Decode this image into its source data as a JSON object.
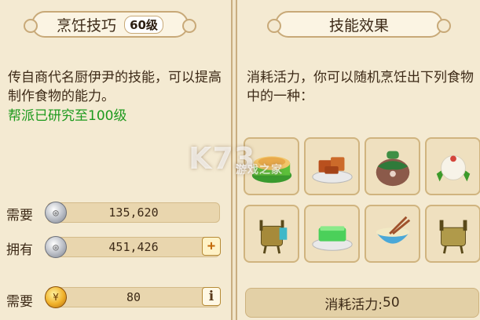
{
  "left": {
    "title": "烹饪技巧",
    "level": "60级",
    "description": "传自商代名厨伊尹的技能，可以提高制作食物的能力。",
    "guild_research": "帮派已研究至100级",
    "requirements": [
      {
        "label": "需要",
        "value": "135,620",
        "currency_icon": "silver-coin-icon"
      },
      {
        "label": "拥有",
        "value": "451,426",
        "currency_icon": "silver-coin-icon",
        "action": "+"
      },
      {
        "label": "需要",
        "value": "80",
        "currency_icon": "gold-coin-icon",
        "action": "i"
      }
    ]
  },
  "right": {
    "title": "技能效果",
    "description": "消耗活力，你可以随机烹饪出下列食物中的一种：",
    "foods": [
      "green-cake-food-icon",
      "tofu-dish-food-icon",
      "wine-jar-food-icon",
      "rice-ball-food-icon",
      "bronze-vessel-food-icon",
      "jade-jelly-food-icon",
      "noodle-bowl-food-icon",
      "bronze-ding-food-icon"
    ],
    "cost_label": "消耗活力:",
    "cost_value": "50"
  },
  "watermark": {
    "text": "K73",
    "sub": "游戏之家"
  }
}
